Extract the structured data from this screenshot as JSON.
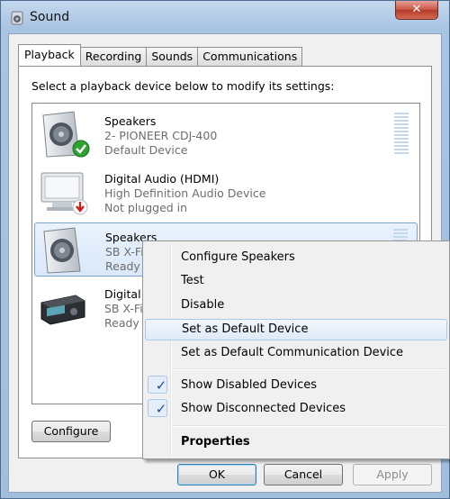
{
  "window": {
    "title": "Sound",
    "close_glyph": "✕",
    "icon": "speaker-icon"
  },
  "tabs": [
    {
      "label": "Playback",
      "active": true
    },
    {
      "label": "Recording"
    },
    {
      "label": "Sounds"
    },
    {
      "label": "Communications"
    }
  ],
  "prompt": "Select a playback device below to modify its settings:",
  "devices": [
    {
      "name": "Speakers",
      "line2": "2- PIONEER CDJ-400",
      "line3": "Default Device",
      "icon": "speaker-icon",
      "badge": "green-check-icon"
    },
    {
      "name": "Digital Audio (HDMI)",
      "line2": "High Definition Audio Device",
      "line3": "Not plugged in",
      "icon": "monitor-icon",
      "badge": "red-down-arrow-icon"
    },
    {
      "name": "Speakers",
      "line2": "SB X-Fi",
      "line3": "Ready",
      "icon": "speaker-icon",
      "selected": true
    },
    {
      "name": "Digital A",
      "line2": "SB X-Fi",
      "line3": "Ready",
      "icon": "receiver-icon"
    }
  ],
  "buttons": {
    "configure": "Configure",
    "ok": "OK",
    "cancel": "Cancel",
    "apply": "Apply"
  },
  "context_menu": {
    "items": [
      {
        "label": "Configure Speakers"
      },
      {
        "label": "Test"
      },
      {
        "label": "Disable"
      },
      {
        "label": "Set as Default Device",
        "hover": true
      },
      {
        "label": "Set as Default Communication Device"
      },
      {
        "label": "Show Disabled Devices",
        "checked": true
      },
      {
        "label": "Show Disconnected Devices",
        "checked": true
      },
      {
        "label": "Properties",
        "bold": true
      }
    ],
    "check_glyph": "✓"
  },
  "colors": {
    "accent": "#3c7fb1",
    "check": "#1b4f9c",
    "selection": "#d9e8fa"
  }
}
